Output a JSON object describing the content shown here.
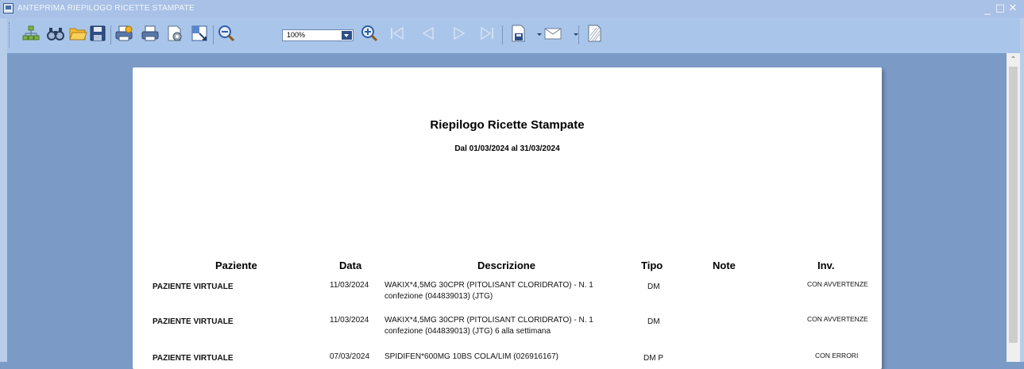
{
  "window": {
    "title": "ANTEPRIMA RIEPILOGO RICETTE STAMPATE",
    "minimize": "_",
    "maximize": "□",
    "close": "✕"
  },
  "toolbar": {
    "icons": [
      "tree-icon",
      "find-icon",
      "open-icon",
      "save-icon",
      "print-dialog-icon",
      "print-icon",
      "page-setup-icon",
      "scale-icon",
      "zoom-out-icon",
      "zoom-in-icon",
      "first-page-icon",
      "previous-page-icon",
      "next-page-icon",
      "last-page-icon",
      "export-icon",
      "email-icon",
      "watermark-icon"
    ],
    "zoom": "100%"
  },
  "report": {
    "title": "Riepilogo Ricette Stampate",
    "subtitle": "Dal 01/03/2024 al 31/03/2024",
    "columns": {
      "paziente": "Paziente",
      "data": "Data",
      "descrizione": "Descrizione",
      "tipo": "Tipo",
      "note": "Note",
      "inv": "Inv."
    },
    "rows": [
      {
        "paziente": "PAZIENTE VIRTUALE",
        "data": "11/03/2024",
        "desc1": "WAKIX*4,5MG 30CPR (PITOLISANT CLORIDRATO) - N. 1",
        "desc2": "confezione (044839013) (JTG)",
        "tipo": "DM",
        "note": "",
        "inv": "CON AVVERTENZE"
      },
      {
        "paziente": "PAZIENTE VIRTUALE",
        "data": "11/03/2024",
        "desc1": "WAKIX*4,5MG 30CPR (PITOLISANT CLORIDRATO) - N. 1",
        "desc2": "confezione (044839013) (JTG) 6 alla settimana",
        "tipo": "DM",
        "note": "",
        "inv": "CON AVVERTENZE"
      },
      {
        "paziente": "PAZIENTE VIRTUALE",
        "data": "07/03/2024",
        "desc1": "SPIDIFEN*600MG 10BS COLA/LIM (026916167)",
        "desc2": "",
        "tipo": "DM P",
        "note": "",
        "inv": "CON ERRORI"
      }
    ]
  }
}
